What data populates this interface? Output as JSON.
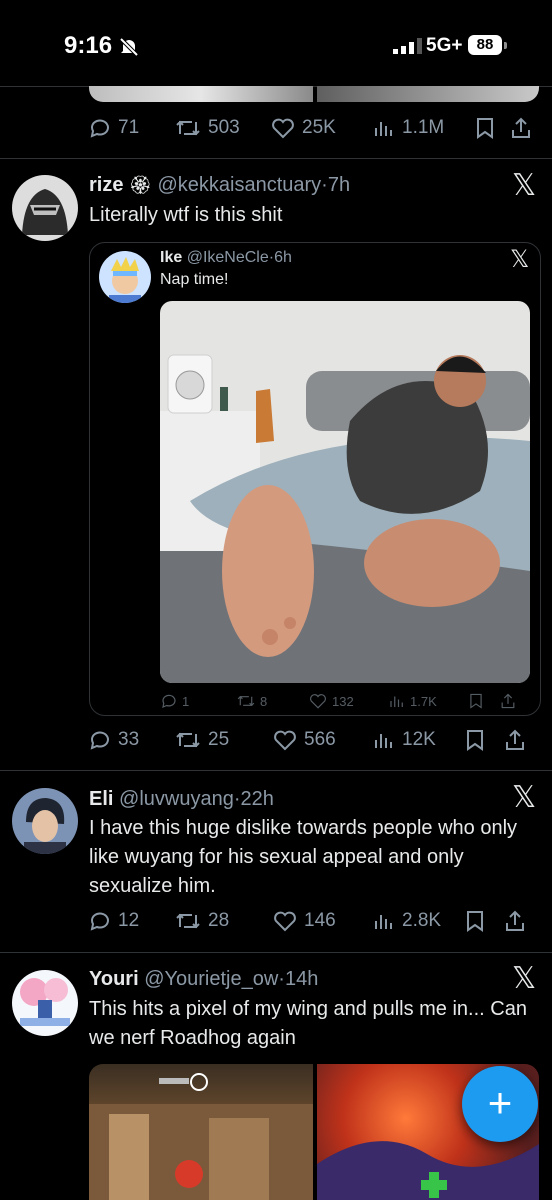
{
  "status_bar": {
    "time": "9:16",
    "network": "5G+",
    "battery": "88"
  },
  "prev_tweet": {
    "stats": {
      "replies": "71",
      "retweets": "503",
      "likes": "25K",
      "views": "1.1M"
    }
  },
  "tweets": [
    {
      "name": "rize",
      "handle": "@kekkaisanctuary",
      "time": "7h",
      "text": "Literally wtf is this shit",
      "quote": {
        "name": "Ike",
        "handle": "@IkeNeCle",
        "time": "6h",
        "text": "Nap time!",
        "stats": {
          "replies": "1",
          "retweets": "8",
          "likes": "132",
          "views": "1.7K"
        }
      },
      "stats": {
        "replies": "33",
        "retweets": "25",
        "likes": "566",
        "views": "12K"
      }
    },
    {
      "name": "Eli",
      "handle": "@luvwuyang",
      "time": "22h",
      "text": "I have this huge dislike towards people who only like wuyang for his sexual appeal and only sexualize him.",
      "stats": {
        "replies": "12",
        "retweets": "28",
        "likes": "146",
        "views": "2.8K"
      }
    },
    {
      "name": "Youri",
      "handle": "@Yourietje_ow",
      "time": "14h",
      "text": "This hits a pixel of my wing and pulls me in... Can we nerf Roadhog again"
    }
  ],
  "colors": {
    "accent": "#1d9bf0",
    "muted": "#8b98a5",
    "divider": "#2f3336"
  }
}
